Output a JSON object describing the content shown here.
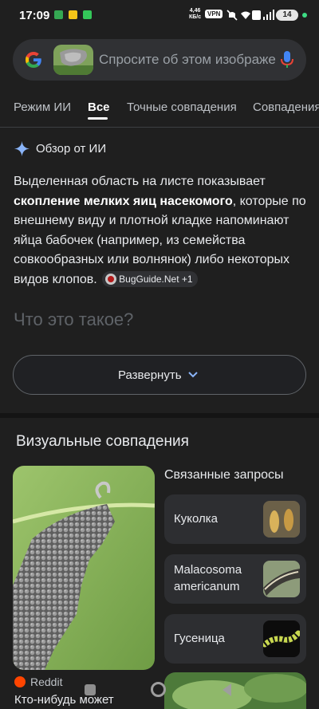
{
  "status_bar": {
    "time": "17:09",
    "net_speed_value": "4,46",
    "net_speed_unit": "КБ/с",
    "vpn": "VPN",
    "battery": "14"
  },
  "search": {
    "placeholder": "Спросите об этом изображении"
  },
  "tabs": [
    "Режим ИИ",
    "Все",
    "Точные совпадения",
    "Совпадения"
  ],
  "ai_overview": {
    "title": "Обзор от ИИ",
    "text_before": "Выделенная область на листе показывает ",
    "text_bold": "скопление мелких яиц насекомого",
    "text_after": ", которые по внешнему виду и плотной кладке напоминают яйца бабочек (например, из семейства совкообразных или волнянок) либо некоторых видов клопов.",
    "source_chip": "BugGuide.Net +1",
    "faded_question": "Что это такое?",
    "expand_label": "Развернуть"
  },
  "visual_matches": {
    "title": "Визуальные совпадения",
    "source": "Reddit",
    "caption": "Кто-нибудь может"
  },
  "related": {
    "title": "Связанные запросы",
    "items": [
      {
        "label": "Куколка"
      },
      {
        "label_line1": "Malacosoma",
        "label_line2": "americanum"
      },
      {
        "label": "Гусеница"
      }
    ]
  },
  "colors": {
    "background": "#1f1f1f",
    "accent_blue": "#8ab4f8",
    "card": "#2d2e31"
  }
}
